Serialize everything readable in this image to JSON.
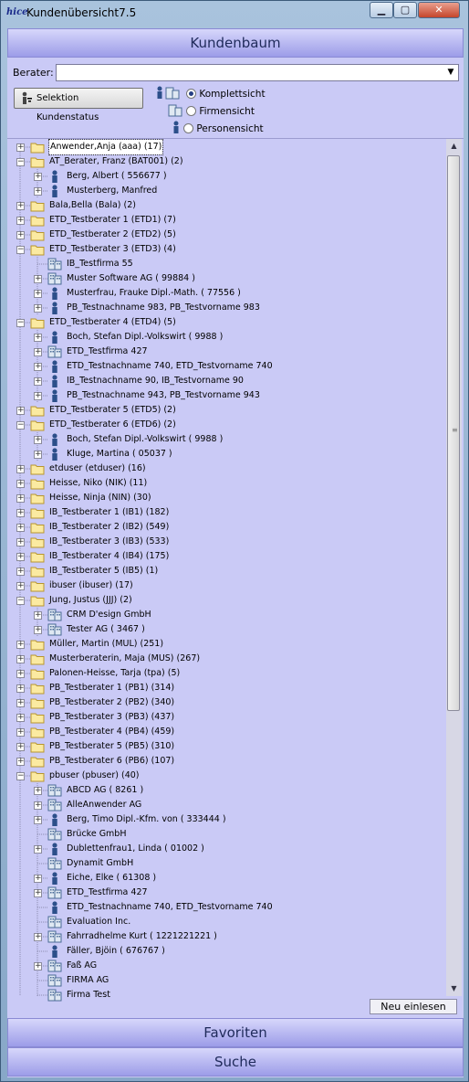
{
  "window": {
    "app_icon": "hice",
    "title": "Kundenübersicht7.5",
    "controls": [
      "minimize-icon",
      "maximize-icon",
      "close-icon"
    ]
  },
  "header": {
    "title": "Kundenbaum"
  },
  "berater": {
    "label": "Berater:",
    "value": ""
  },
  "selektion_button": {
    "label": "Selektion Kundenstatus",
    "icon": "user-filter-icon"
  },
  "views": [
    {
      "label": "Komplettsicht",
      "checked": true,
      "icon": "person-company-icon"
    },
    {
      "label": "Firmensicht",
      "checked": false,
      "icon": "company-icon"
    },
    {
      "label": "Personensicht",
      "checked": false,
      "icon": "person-icon"
    }
  ],
  "tree": [
    {
      "level": 0,
      "type": "folder",
      "exp": "+",
      "label": "Anwender,Anja (aaa)  (17)",
      "selected": true
    },
    {
      "level": 0,
      "type": "folder",
      "exp": "-",
      "label": "AT_Berater, Franz (BAT001)  (2)"
    },
    {
      "level": 1,
      "type": "person",
      "exp": "+",
      "label": "Berg, Albert ( 556677 )"
    },
    {
      "level": 1,
      "type": "person",
      "exp": "+",
      "label": "Musterberg, Manfred"
    },
    {
      "level": 0,
      "type": "folder",
      "exp": "+",
      "label": "Bala,Bella (Bala)  (2)"
    },
    {
      "level": 0,
      "type": "folder",
      "exp": "+",
      "label": "ETD_Testberater 1 (ETD1)  (7)"
    },
    {
      "level": 0,
      "type": "folder",
      "exp": "+",
      "label": "ETD_Testberater 2 (ETD2)  (5)"
    },
    {
      "level": 0,
      "type": "folder",
      "exp": "-",
      "label": "ETD_Testberater 3 (ETD3)  (4)"
    },
    {
      "level": 1,
      "type": "company",
      "exp": "",
      "label": "IB_Testfirma 55"
    },
    {
      "level": 1,
      "type": "company",
      "exp": "+",
      "label": "Muster Software AG ( 99884 )"
    },
    {
      "level": 1,
      "type": "person",
      "exp": "+",
      "label": "Musterfrau, Frauke Dipl.-Math. ( 77556 )"
    },
    {
      "level": 1,
      "type": "person",
      "exp": "+",
      "label": "PB_Testnachname 983, PB_Testvorname 983"
    },
    {
      "level": 0,
      "type": "folder",
      "exp": "-",
      "label": "ETD_Testberater 4 (ETD4)  (5)"
    },
    {
      "level": 1,
      "type": "person",
      "exp": "+",
      "label": "Boch, Stefan Dipl.-Volkswirt ( 9988 )"
    },
    {
      "level": 1,
      "type": "company",
      "exp": "+",
      "label": "ETD_Testfirma 427"
    },
    {
      "level": 1,
      "type": "person",
      "exp": "+",
      "label": "ETD_Testnachname 740, ETD_Testvorname 740"
    },
    {
      "level": 1,
      "type": "person",
      "exp": "+",
      "label": "IB_Testnachname 90, IB_Testvorname 90"
    },
    {
      "level": 1,
      "type": "person",
      "exp": "+",
      "label": "PB_Testnachname 943, PB_Testvorname 943"
    },
    {
      "level": 0,
      "type": "folder",
      "exp": "+",
      "label": "ETD_Testberater 5 (ETD5)  (2)"
    },
    {
      "level": 0,
      "type": "folder",
      "exp": "-",
      "label": "ETD_Testberater 6 (ETD6)  (2)"
    },
    {
      "level": 1,
      "type": "person",
      "exp": "+",
      "label": "Boch, Stefan Dipl.-Volkswirt ( 9988 )"
    },
    {
      "level": 1,
      "type": "person",
      "exp": "+",
      "label": "Kluge, Martina ( 05037 )"
    },
    {
      "level": 0,
      "type": "folder",
      "exp": "+",
      "label": "etduser (etduser)  (16)"
    },
    {
      "level": 0,
      "type": "folder",
      "exp": "+",
      "label": "Heisse, Niko (NIK)  (11)"
    },
    {
      "level": 0,
      "type": "folder",
      "exp": "+",
      "label": "Heisse, Ninja (NIN)  (30)"
    },
    {
      "level": 0,
      "type": "folder",
      "exp": "+",
      "label": "IB_Testberater 1 (IB1)  (182)"
    },
    {
      "level": 0,
      "type": "folder",
      "exp": "+",
      "label": "IB_Testberater 2 (IB2)  (549)"
    },
    {
      "level": 0,
      "type": "folder",
      "exp": "+",
      "label": "IB_Testberater 3 (IB3)  (533)"
    },
    {
      "level": 0,
      "type": "folder",
      "exp": "+",
      "label": "IB_Testberater 4 (IB4)  (175)"
    },
    {
      "level": 0,
      "type": "folder",
      "exp": "+",
      "label": "IB_Testberater 5 (IB5)  (1)"
    },
    {
      "level": 0,
      "type": "folder",
      "exp": "+",
      "label": "ibuser (ibuser)  (17)"
    },
    {
      "level": 0,
      "type": "folder",
      "exp": "-",
      "label": "Jung, Justus (JJJ)  (2)"
    },
    {
      "level": 1,
      "type": "company",
      "exp": "+",
      "label": "CRM D'esign GmbH"
    },
    {
      "level": 1,
      "type": "company",
      "exp": "+",
      "label": "Tester AG ( 3467 )"
    },
    {
      "level": 0,
      "type": "folder",
      "exp": "+",
      "label": "Müller, Martin (MUL)  (251)"
    },
    {
      "level": 0,
      "type": "folder",
      "exp": "+",
      "label": "Musterberaterin, Maja (MUS)  (267)"
    },
    {
      "level": 0,
      "type": "folder",
      "exp": "+",
      "label": "Palonen-Heisse, Tarja (tpa)  (5)"
    },
    {
      "level": 0,
      "type": "folder",
      "exp": "+",
      "label": "PB_Testberater 1 (PB1)  (314)"
    },
    {
      "level": 0,
      "type": "folder",
      "exp": "+",
      "label": "PB_Testberater 2 (PB2)  (340)"
    },
    {
      "level": 0,
      "type": "folder",
      "exp": "+",
      "label": "PB_Testberater 3 (PB3)  (437)"
    },
    {
      "level": 0,
      "type": "folder",
      "exp": "+",
      "label": "PB_Testberater 4 (PB4)  (459)"
    },
    {
      "level": 0,
      "type": "folder",
      "exp": "+",
      "label": "PB_Testberater 5 (PB5)  (310)"
    },
    {
      "level": 0,
      "type": "folder",
      "exp": "+",
      "label": "PB_Testberater 6 (PB6)  (107)"
    },
    {
      "level": 0,
      "type": "folder",
      "exp": "-",
      "label": "pbuser (pbuser)  (40)"
    },
    {
      "level": 1,
      "type": "company",
      "exp": "+",
      "label": "ABCD AG ( 8261 )"
    },
    {
      "level": 1,
      "type": "company",
      "exp": "+",
      "label": "AlleAnwender AG"
    },
    {
      "level": 1,
      "type": "person",
      "exp": "+",
      "label": "Berg, Timo Dipl.-Kfm. von ( 333444 )"
    },
    {
      "level": 1,
      "type": "company",
      "exp": "",
      "label": "Brücke GmbH"
    },
    {
      "level": 1,
      "type": "person",
      "exp": "+",
      "label": "Dublettenfrau1, Linda ( 01002 )"
    },
    {
      "level": 1,
      "type": "company",
      "exp": "",
      "label": "Dynamit GmbH"
    },
    {
      "level": 1,
      "type": "person",
      "exp": "+",
      "label": "Eiche, Elke ( 61308 )"
    },
    {
      "level": 1,
      "type": "company",
      "exp": "+",
      "label": "ETD_Testfirma 427"
    },
    {
      "level": 1,
      "type": "person",
      "exp": "",
      "label": "ETD_Testnachname 740, ETD_Testvorname 740"
    },
    {
      "level": 1,
      "type": "company",
      "exp": "",
      "label": "Evaluation Inc."
    },
    {
      "level": 1,
      "type": "company",
      "exp": "+",
      "label": "Fahrradhelme Kurt ( 1221221221 )"
    },
    {
      "level": 1,
      "type": "person",
      "exp": "",
      "label": "Fäller, Bjöin ( 676767 )"
    },
    {
      "level": 1,
      "type": "company",
      "exp": "+",
      "label": "Faß AG"
    },
    {
      "level": 1,
      "type": "company",
      "exp": "",
      "label": "FIRMA AG"
    },
    {
      "level": 1,
      "type": "company",
      "exp": "",
      "label": "Firma Test"
    }
  ],
  "buttons": {
    "neu_einlesen": "Neu einlesen"
  },
  "footer": {
    "favoriten": "Favoriten",
    "suche": "Suche"
  }
}
